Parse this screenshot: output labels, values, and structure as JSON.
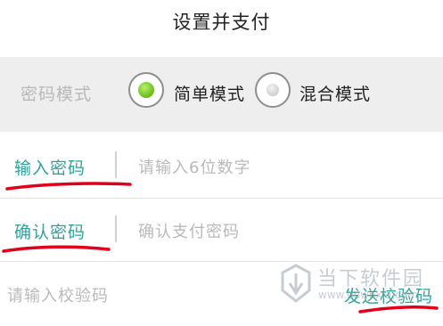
{
  "header": {
    "title": "设置并支付"
  },
  "mode": {
    "label": "密码模式",
    "options": [
      {
        "label": "简单模式",
        "selected": true
      },
      {
        "label": "混合模式",
        "selected": false
      }
    ],
    "selected_color": "#71c51d"
  },
  "password": {
    "label": "输入密码",
    "placeholder": "请输入6位数字"
  },
  "confirm": {
    "label": "确认密码",
    "placeholder": "确认支付密码"
  },
  "verify": {
    "placeholder": "请输入校验码",
    "send_label": "发送校验码"
  },
  "watermark": {
    "cn": "当下软件园",
    "en": "www.downxia.com"
  },
  "colors": {
    "accent": "#2fa39a",
    "annotation": "#e0001b"
  },
  "icons": {
    "watermark_logo": "watermark-logo-icon"
  }
}
